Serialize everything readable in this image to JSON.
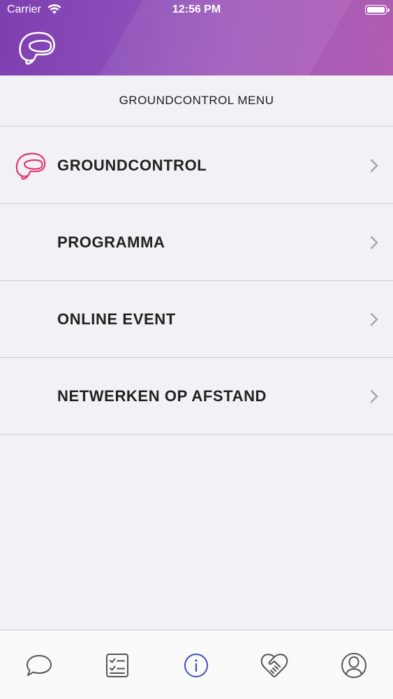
{
  "status_bar": {
    "carrier": "Carrier",
    "time": "12:56 PM"
  },
  "header": {
    "logo_icon": "helmet-logo-icon",
    "gradient_start": "#7d3fb0",
    "gradient_end": "#b05cb2"
  },
  "page": {
    "title": "GROUNDCONTROL MENU"
  },
  "menu": {
    "items": [
      {
        "label": "GROUNDCONTROL",
        "icon": "helmet-icon",
        "icon_color": "#e0336e"
      },
      {
        "label": "PROGRAMMA"
      },
      {
        "label": "ONLINE EVENT"
      },
      {
        "label": "NETWERKEN OP AFSTAND"
      }
    ]
  },
  "tabbar": {
    "tabs": [
      {
        "icon": "chat-bubble-icon",
        "active": false
      },
      {
        "icon": "checklist-icon",
        "active": false
      },
      {
        "icon": "info-icon",
        "active": true
      },
      {
        "icon": "handshake-icon",
        "active": false
      },
      {
        "icon": "profile-icon",
        "active": false
      }
    ],
    "active_color": "#3d4fc4",
    "inactive_color": "#555555"
  }
}
